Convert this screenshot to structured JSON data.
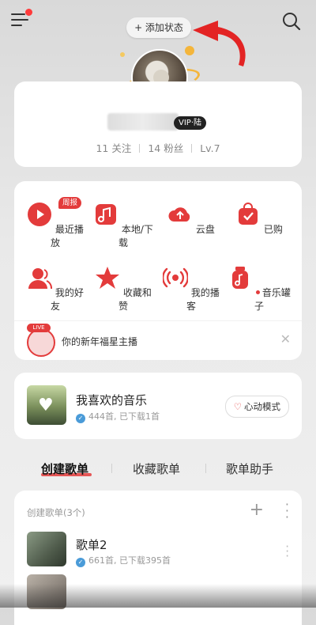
{
  "header": {
    "add_status_label": "+ 添加状态"
  },
  "profile": {
    "vip_badge": "VIP·陆",
    "follows": "11 关注",
    "fans": "14 粉丝",
    "level": "Lv.7"
  },
  "grid": {
    "items": [
      {
        "label": "最近播放",
        "icon": "play-icon",
        "badge": "周报"
      },
      {
        "label": "本地/下载",
        "icon": "music-folder-icon"
      },
      {
        "label": "云盘",
        "icon": "cloud-upload-icon"
      },
      {
        "label": "已购",
        "icon": "shopping-bag-icon"
      },
      {
        "label": "我的好友",
        "icon": "friends-icon"
      },
      {
        "label": "收藏和赞",
        "icon": "star-icon"
      },
      {
        "label": "我的播客",
        "icon": "podcast-icon"
      },
      {
        "label": "音乐罐子",
        "icon": "music-jar-icon"
      }
    ],
    "live_tag": "LIVE",
    "live_text": "你的新年福星主播"
  },
  "favorites": {
    "title": "我喜欢的音乐",
    "subtitle": "444首, 已下载1首",
    "mode_button": "心动模式"
  },
  "tabs": [
    {
      "label": "创建歌单",
      "active": true
    },
    {
      "label": "收藏歌单",
      "active": false
    },
    {
      "label": "歌单助手",
      "active": false
    }
  ],
  "playlists": {
    "header": "创建歌单(3个)",
    "items": [
      {
        "title": "歌单2",
        "subtitle": "661首, 已下载395首"
      }
    ]
  },
  "colors": {
    "accent": "#e33b3b",
    "background": "#e6e6e6",
    "card": "#ffffff"
  }
}
